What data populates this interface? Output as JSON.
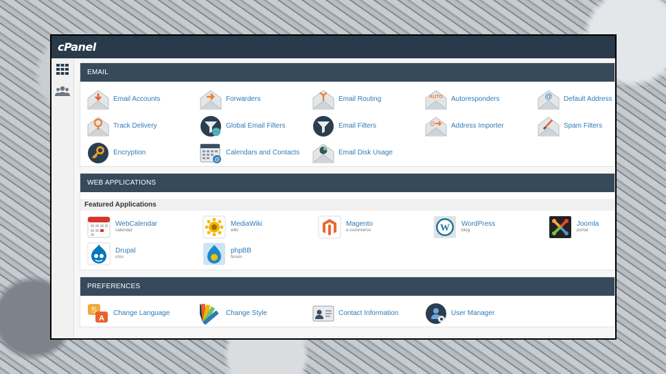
{
  "app": {
    "logo": "cPanel"
  },
  "sidenav": {
    "items": [
      {
        "icon": "grid-icon"
      },
      {
        "icon": "users-icon"
      }
    ]
  },
  "email": {
    "title": "EMAIL",
    "items": [
      {
        "label": "Email Accounts",
        "icon": "email-accounts-icon"
      },
      {
        "label": "Forwarders",
        "icon": "forwarders-icon"
      },
      {
        "label": "Email Routing",
        "icon": "email-routing-icon"
      },
      {
        "label": "Autoresponders",
        "icon": "autoresponders-icon",
        "badge": "AUTO"
      },
      {
        "label": "Default Address",
        "icon": "default-address-icon"
      },
      {
        "label": "Track Delivery",
        "icon": "track-delivery-icon"
      },
      {
        "label": "Global Email Filters",
        "icon": "global-filters-icon"
      },
      {
        "label": "Email Filters",
        "icon": "email-filters-icon"
      },
      {
        "label": "Address Importer",
        "icon": "address-importer-icon"
      },
      {
        "label": "Spam Filters",
        "icon": "spam-filters-icon"
      },
      {
        "label": "Encryption",
        "icon": "encryption-icon"
      },
      {
        "label": "Calendars and Contacts",
        "icon": "calendars-icon"
      },
      {
        "label": "Email Disk Usage",
        "icon": "disk-usage-icon"
      }
    ]
  },
  "webapps": {
    "title": "WEB APPLICATIONS",
    "featured_label": "Featured Applications",
    "apps": [
      {
        "name": "WebCalendar",
        "category": "calendar",
        "icon": "webcalendar-icon"
      },
      {
        "name": "MediaWiki",
        "category": "wiki",
        "icon": "mediawiki-icon"
      },
      {
        "name": "Magento",
        "category": "e-commerce",
        "icon": "magento-icon"
      },
      {
        "name": "WordPress",
        "category": "blog",
        "icon": "wordpress-icon"
      },
      {
        "name": "Joomla",
        "category": "portal",
        "icon": "joomla-icon"
      },
      {
        "name": "Drupal",
        "category": "cms",
        "icon": "drupal-icon"
      },
      {
        "name": "phpBB",
        "category": "forum",
        "icon": "phpbb-icon"
      }
    ]
  },
  "preferences": {
    "title": "PREFERENCES",
    "items": [
      {
        "label": "Change Language",
        "icon": "change-language-icon"
      },
      {
        "label": "Change Style",
        "icon": "change-style-icon"
      },
      {
        "label": "Contact Information",
        "icon": "contact-info-icon"
      },
      {
        "label": "User Manager",
        "icon": "user-manager-icon"
      }
    ]
  },
  "colors": {
    "header": "#293a4a",
    "panel_header": "#364a5c",
    "link": "#2e7ab8",
    "accent": "#f07c2c"
  }
}
